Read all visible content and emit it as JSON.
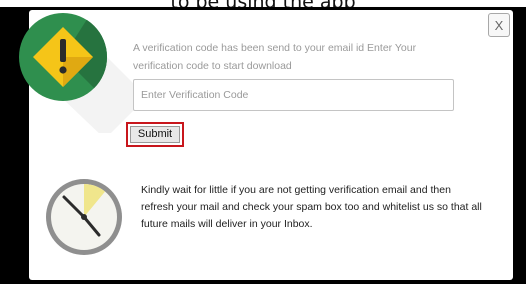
{
  "header": {
    "partial_text": "to be using the app"
  },
  "dialog": {
    "close_label": "X",
    "message": "A verification code has been send to your email id Enter Your verification code to start download",
    "code_input": {
      "value": "",
      "placeholder": "Enter Verification Code"
    },
    "submit_label": "Submit",
    "notice": "Kindly wait for little if you are not getting verification email and then refresh your mail and check your spam box too and whitelist us so that all future mails will deliver in your Inbox."
  },
  "icons": {
    "warning": "warning-icon",
    "clock": "clock-icon"
  },
  "colors": {
    "warning_circle": "#2f8f4e",
    "warning_diamond": "#f5c518",
    "submit_outline": "#c8161c",
    "clock_elapsed": "#f0e68c"
  }
}
